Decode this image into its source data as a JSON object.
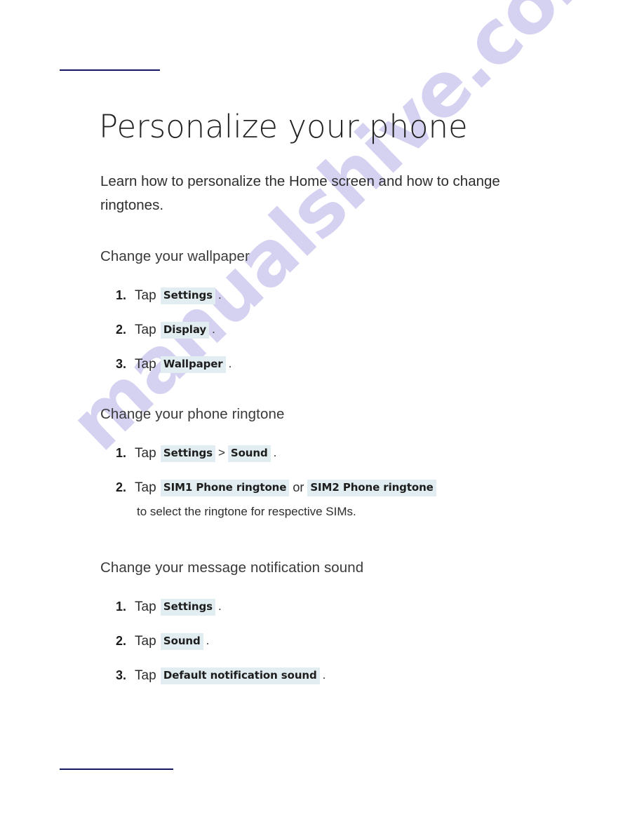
{
  "document": {
    "title": "Personalize your phone",
    "intro": "Learn how to personalize the Home screen and how to change ringtones.",
    "header_faint": "Personalize your phone",
    "watermark": "manualshive.com"
  },
  "colors": {
    "rule": "#151560",
    "token_background": "#e2edf1",
    "token_text": "#1d1d1d",
    "body_text": "#2d2d2d",
    "heading_text": "#3a3a3a",
    "title_text": "#232323",
    "watermark": "#cdc9ef"
  },
  "sections": [
    {
      "heading": "Change your wallpaper",
      "steps": [
        {
          "verb": "Tap",
          "tokens": [
            "Settings"
          ],
          "trailing": "."
        },
        {
          "verb": "Tap",
          "tokens": [
            "Display"
          ],
          "trailing": "."
        },
        {
          "verb": "Tap",
          "tokens": [
            "Wallpaper"
          ],
          "trailing": "."
        }
      ]
    },
    {
      "heading": "Change your phone ringtone",
      "steps": [
        {
          "verb": "Tap",
          "tokens": [
            "Settings",
            "Sound"
          ],
          "separator": ">",
          "trailing": "."
        },
        {
          "verb": "Tap",
          "tokens": [
            "SIM1 Phone ringtone",
            "SIM2 Phone ringtone"
          ],
          "conjunction": "or",
          "trailing": "to select the ringtone for respective SIMs."
        }
      ]
    },
    {
      "heading": "Change your message notification sound",
      "steps": [
        {
          "verb": "Tap",
          "tokens": [
            "Settings"
          ],
          "trailing": "."
        },
        {
          "verb": "Tap",
          "tokens": [
            "Sound"
          ],
          "trailing": "."
        },
        {
          "verb": "Tap",
          "tokens": [
            "Default notification sound"
          ],
          "trailing": "."
        }
      ]
    }
  ]
}
